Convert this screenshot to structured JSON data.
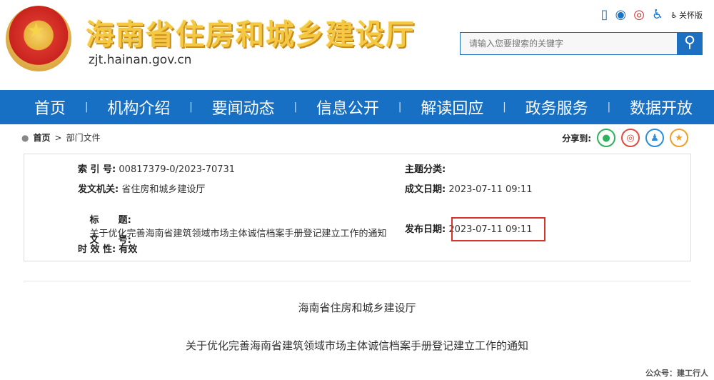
{
  "header": {
    "title": "海南省住房和城乡建设厅",
    "domain": "zjt.hainan.gov.cn",
    "care_label": "关怀版",
    "search_placeholder": "请输入您要搜索的关键字"
  },
  "icons": [
    "mobile-icon",
    "wechat-icon",
    "weibo-icon",
    "accessibility-icon",
    "care-mode-icon",
    "search-icon"
  ],
  "nav": {
    "items": [
      "首页",
      "机构介绍",
      "要闻动态",
      "信息公开",
      "解读回应",
      "政务服务",
      "数据开放"
    ],
    "separator": "|"
  },
  "breadcrumb": {
    "home": "首页",
    "sep": ">",
    "current": "部门文件"
  },
  "share": {
    "label": "分享到:"
  },
  "meta": {
    "index_label": "索 引 号:",
    "index_value": "00817379-0/2023-70731",
    "topic_label": "主题分类:",
    "topic_value": "",
    "issuer_label": "发文机关:",
    "issuer_value": "省住房和城乡建设厅",
    "created_label": "成文日期:",
    "created_value": "2023-07-11 09:11",
    "title_label": "标      题:",
    "title_value": "关于优化完善海南省建筑领域市场主体诚信档案手册登记建立工作的通知",
    "docno_label": "文      号:",
    "docno_value": "",
    "published_label": "发布日期:",
    "published_value": "2023-07-11 09:11",
    "validity_label": "时 效 性:",
    "validity_value": "有效"
  },
  "body": {
    "org": "海南省住房和城乡建设厅",
    "title": "关于优化完善海南省建筑领域市场主体诚信档案手册登记建立工作的通知"
  },
  "watermark": "公众号：建工行人",
  "colors": {
    "nav_bg": "#1870c5",
    "highlight_border": "#d9342b",
    "title_gold": "#f4c842"
  }
}
